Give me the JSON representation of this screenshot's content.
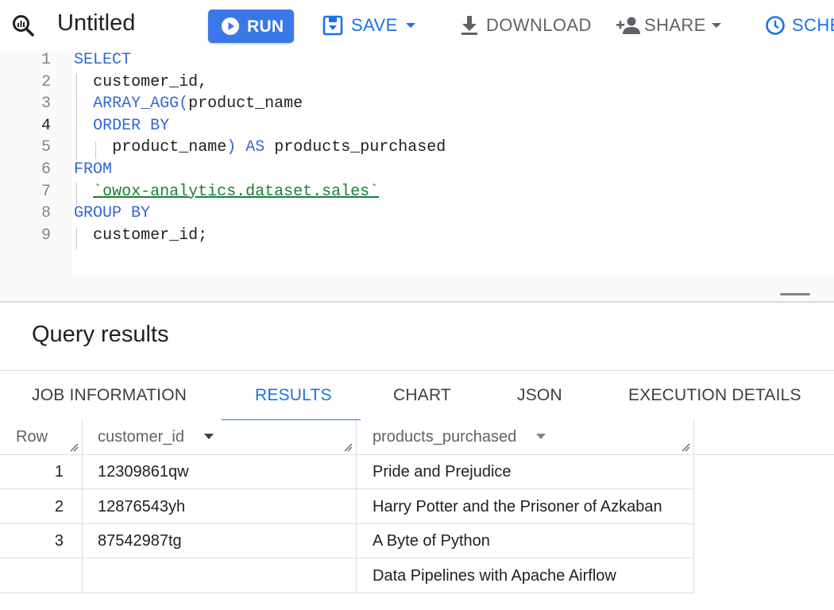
{
  "app": {
    "title": "Untitled"
  },
  "toolbar": {
    "run_label": "RUN",
    "save_label": "SAVE",
    "download_label": "DOWNLOAD",
    "share_label": "SHARE",
    "schedule_label": "SCHE",
    "accent_color": "#1a73e8",
    "run_color": "#3b78e7"
  },
  "editor": {
    "lines": [
      {
        "num": "1",
        "tokens": [
          {
            "t": "SELECT",
            "c": "kw"
          }
        ]
      },
      {
        "num": "2",
        "tokens": [
          {
            "t": "customer_id,",
            "c": "id"
          }
        ]
      },
      {
        "num": "3",
        "tokens": [
          {
            "t": "ARRAY_AGG(",
            "c": "kw"
          },
          {
            "t": "product_name",
            "c": "id"
          }
        ]
      },
      {
        "num": "4",
        "tokens": [
          {
            "t": "ORDER BY",
            "c": "kw"
          }
        ]
      },
      {
        "num": "5",
        "tokens": [
          {
            "t": "product_name",
            "c": "id"
          },
          {
            "t": ")",
            "c": "kw"
          },
          {
            "t": " AS ",
            "c": "kw"
          },
          {
            "t": "products_purchased",
            "c": "id"
          }
        ]
      },
      {
        "num": "6",
        "tokens": [
          {
            "t": "FROM",
            "c": "kw"
          }
        ]
      },
      {
        "num": "7",
        "tokens": [
          {
            "t": "`owox-analytics.dataset.sales`",
            "c": "str"
          }
        ]
      },
      {
        "num": "8",
        "tokens": [
          {
            "t": "GROUP BY",
            "c": "kw"
          }
        ]
      },
      {
        "num": "9",
        "tokens": [
          {
            "t": "customer_id;",
            "c": "id"
          }
        ]
      }
    ],
    "active_line": "4"
  },
  "results": {
    "title": "Query results",
    "tabs": [
      {
        "label": "JOB INFORMATION",
        "active": false
      },
      {
        "label": "RESULTS",
        "active": true
      },
      {
        "label": "CHART",
        "active": false
      },
      {
        "label": "JSON",
        "active": false
      },
      {
        "label": "EXECUTION DETAILS",
        "active": false
      }
    ],
    "table": {
      "headers": {
        "row": "Row",
        "customer_id": "customer_id",
        "products_purchased": "products_purchased"
      },
      "rows": [
        {
          "row": "1",
          "customer_id": "12309861qw",
          "products": [
            "Pride and Prejudice"
          ]
        },
        {
          "row": "2",
          "customer_id": "12876543yh",
          "products": [
            "Harry Potter and the Prisoner of Azkaban"
          ]
        },
        {
          "row": "3",
          "customer_id": "87542987tg",
          "products": [
            "A Byte of Python",
            "Data Pipelines with Apache Airflow"
          ]
        }
      ]
    }
  }
}
